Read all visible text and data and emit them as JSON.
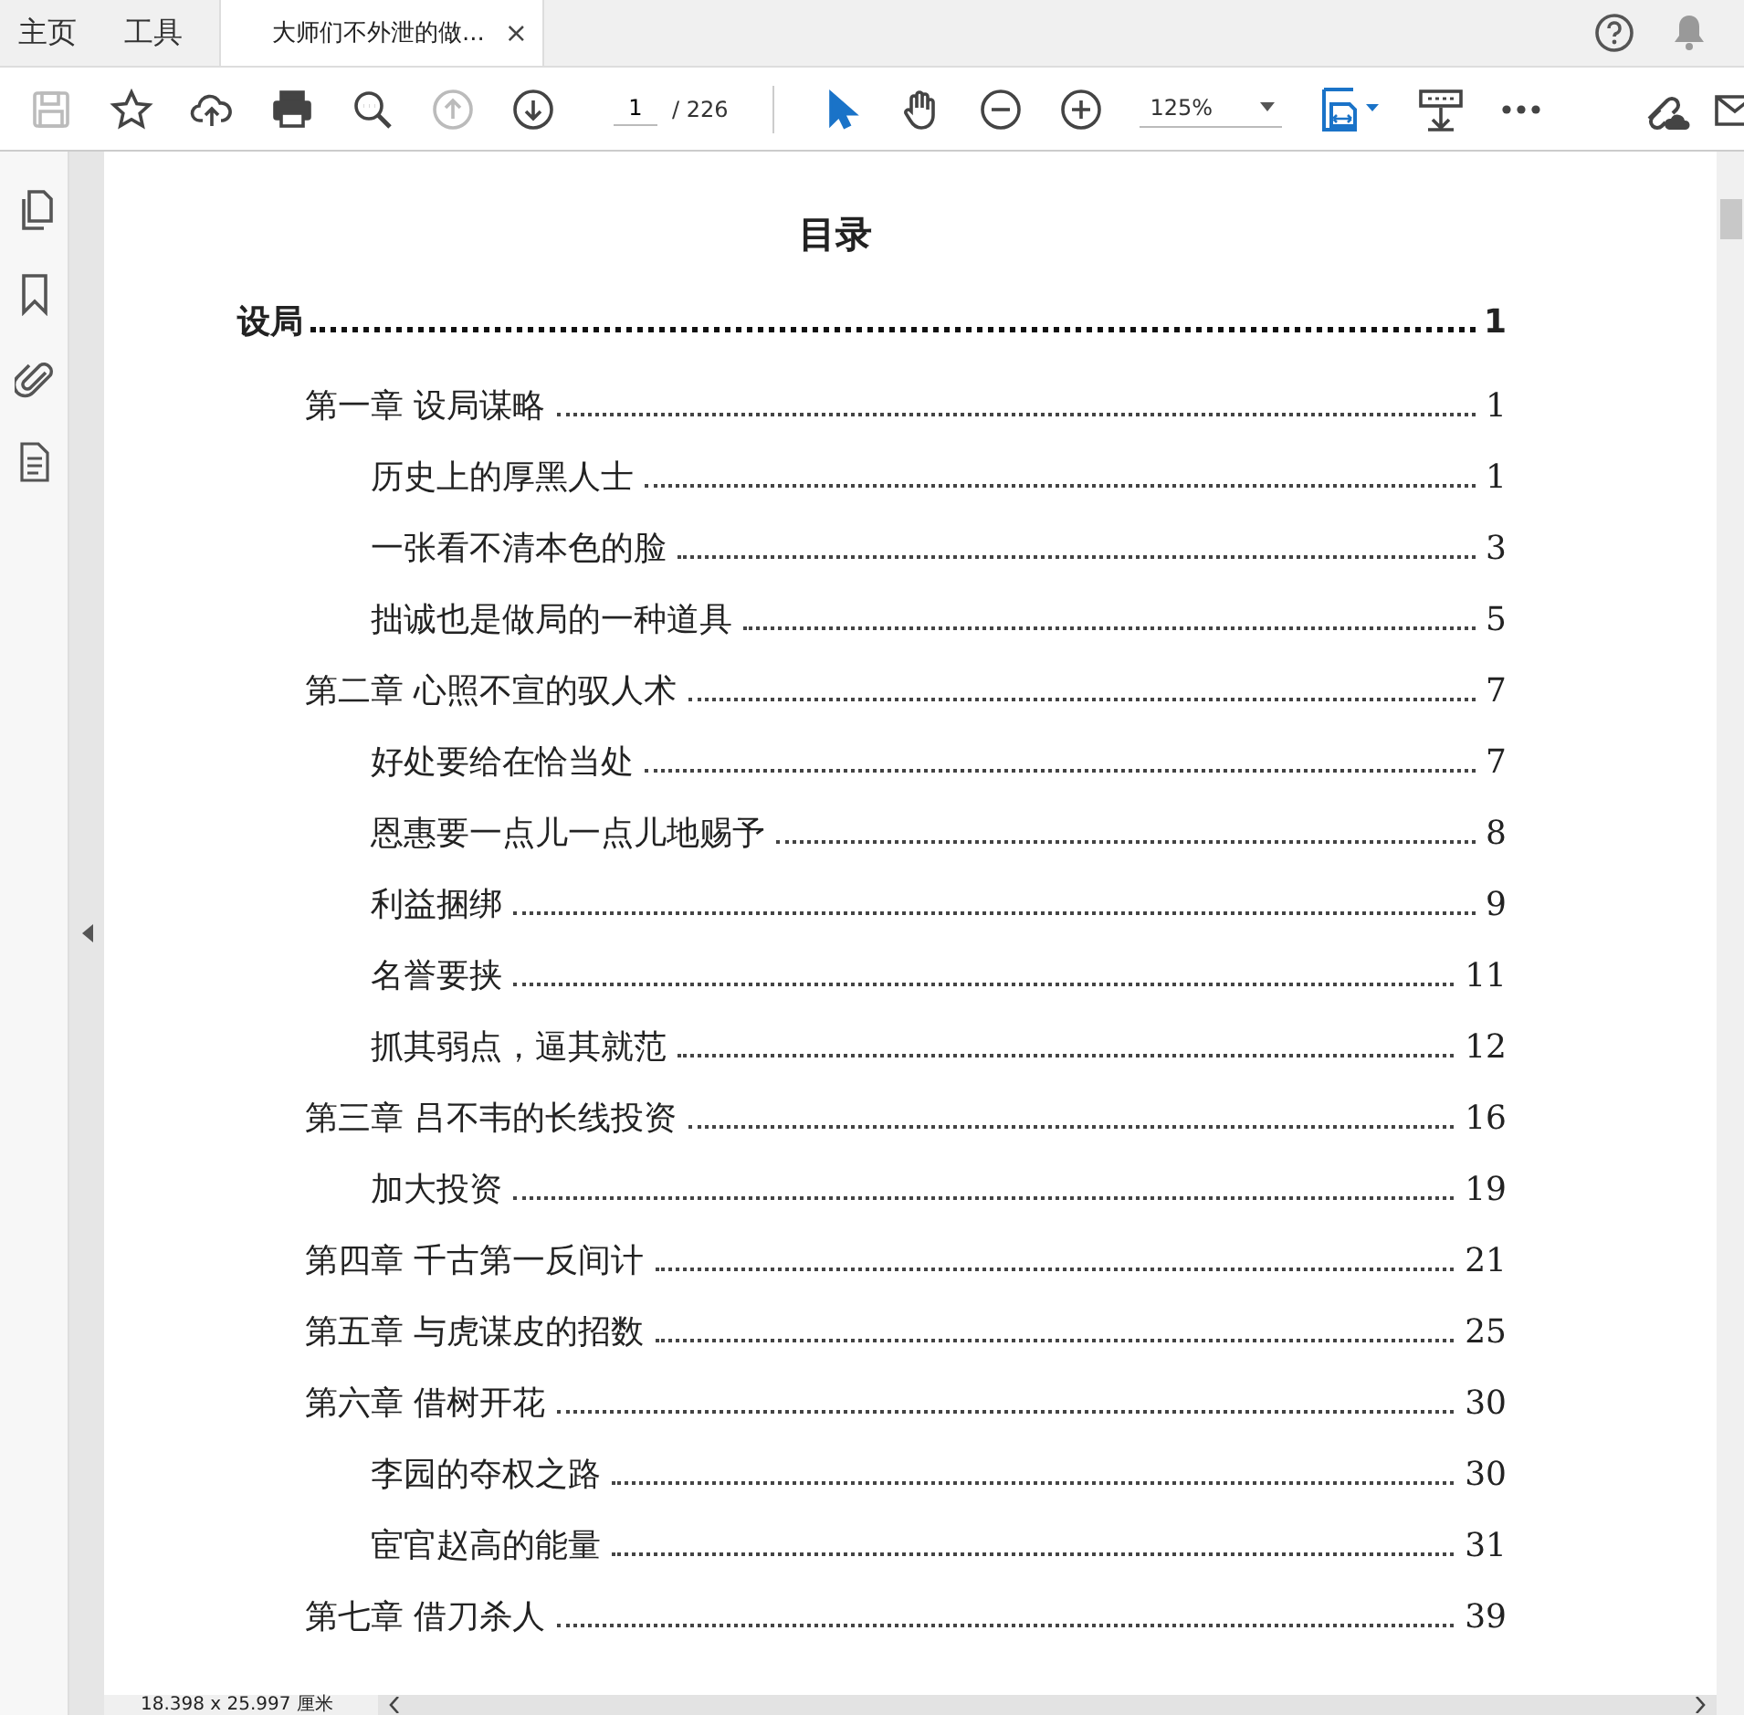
{
  "tabs": [
    {
      "label": "主页",
      "kind": "nav",
      "selected": false
    },
    {
      "label": "工具",
      "kind": "nav",
      "selected": false
    },
    {
      "label": "大师们不外泄的做...",
      "kind": "document",
      "selected": true,
      "close": "×"
    }
  ],
  "toolbar": {
    "tools": [
      {
        "kind": "save",
        "disabled": true
      },
      {
        "kind": "star",
        "disabled": false
      },
      {
        "kind": "upload",
        "disabled": false
      },
      {
        "kind": "print",
        "disabled": false
      },
      {
        "kind": "find",
        "disabled": false
      },
      {
        "kind": "prev",
        "disabled": true
      },
      {
        "kind": "next",
        "disabled": false
      }
    ],
    "page": {
      "value": "1",
      "total": "/ 226"
    },
    "tools2": [
      {
        "kind": "pointer",
        "selected": true
      },
      {
        "kind": "hand",
        "selected": false
      },
      {
        "kind": "zoom-out",
        "selected": false
      },
      {
        "kind": "zoom-in",
        "selected": false
      }
    ],
    "zoom": "125%"
  },
  "document": {
    "title": "目录",
    "toc": [
      {
        "title": "设局",
        "page": "1",
        "children": [
          {
            "title": "第一章  设局谋略",
            "page": "1",
            "children": [
              {
                "title": "历史上的厚黑人士",
                "page": "1"
              },
              {
                "title": "一张看不清本色的脸",
                "page": "3"
              },
              {
                "title": "拙诚也是做局的一种道具",
                "page": "5"
              }
            ]
          },
          {
            "title": "第二章  心照不宣的驭人术",
            "page": "7",
            "children": [
              {
                "title": "好处要给在恰当处",
                "page": "7"
              },
              {
                "title": "恩惠要一点儿一点儿地赐予",
                "page": "8"
              },
              {
                "title": "利益捆绑",
                "page": "9"
              },
              {
                "title": "名誉要挟",
                "page": "11"
              },
              {
                "title": "抓其弱点，逼其就范",
                "page": "12"
              }
            ]
          },
          {
            "title": "第三章  吕不韦的长线投资",
            "page": "16",
            "children": [
              {
                "title": "加大投资",
                "page": "19"
              }
            ]
          },
          {
            "title": "第四章  千古第一反间计",
            "page": "21"
          },
          {
            "title": "第五章  与虎谋皮的招数",
            "page": "25"
          },
          {
            "title": "第六章  借树开花",
            "page": "30",
            "children": [
              {
                "title": "李园的夺权之路",
                "page": "30"
              },
              {
                "title": "宦官赵高的能量",
                "page": "31"
              }
            ]
          },
          {
            "title": "第七章  借刀杀人",
            "page": "39"
          }
        ]
      }
    ]
  },
  "status_bar": {
    "page_size": "18.398 x 25.997 厘米"
  }
}
